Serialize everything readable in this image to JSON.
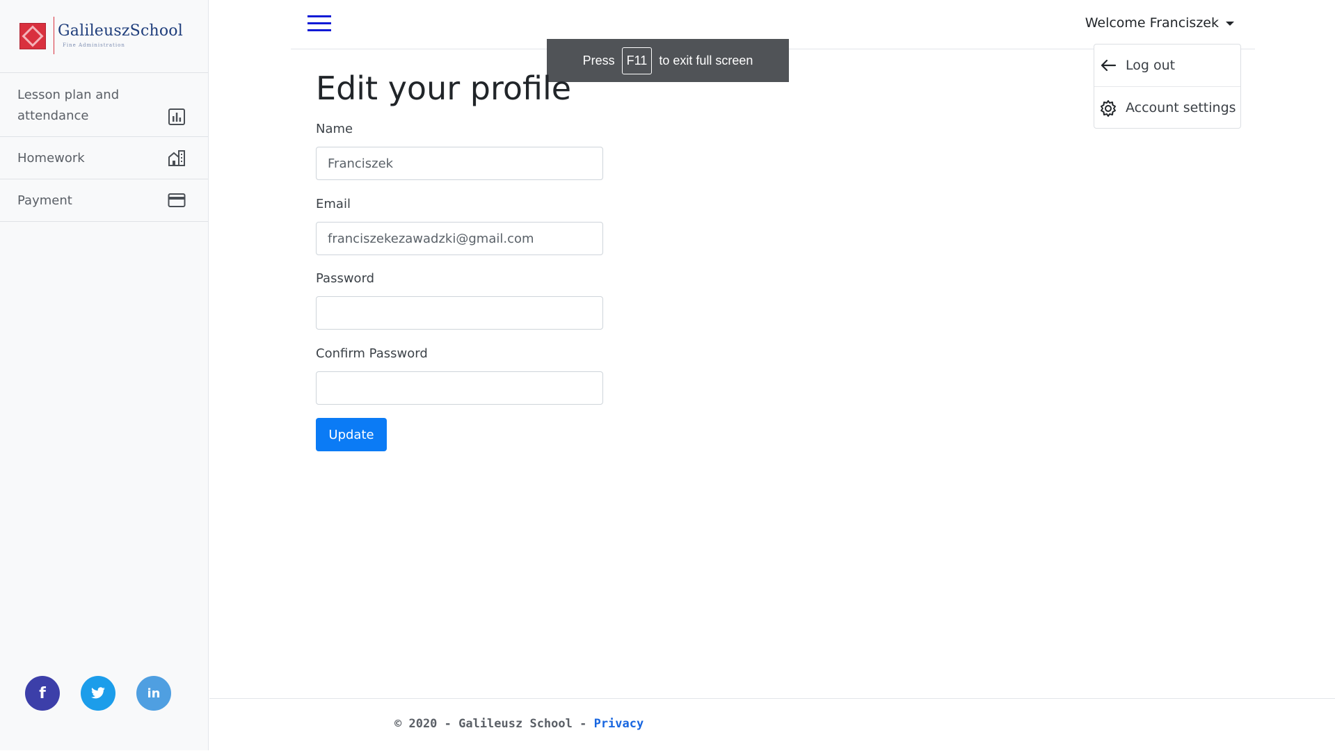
{
  "brand": {
    "name": "GalileuszSchool",
    "subtitle": "Fine Administration"
  },
  "sidebar": {
    "items": [
      {
        "label": "Lesson plan and attendance",
        "icon": "bar-chart-icon"
      },
      {
        "label": "Homework",
        "icon": "building-icon"
      },
      {
        "label": "Payment",
        "icon": "credit-card-icon"
      }
    ],
    "social": [
      {
        "label": "f",
        "icon": "facebook-icon",
        "color": "#3c3fa9"
      },
      {
        "label": "",
        "icon": "twitter-icon",
        "color": "#1c9dea"
      },
      {
        "label": "in",
        "icon": "linkedin-icon",
        "color": "#4f9fe1"
      }
    ]
  },
  "header": {
    "welcome": "Welcome Franciszek",
    "menu": [
      {
        "label": "Log out",
        "icon": "arrow-left-icon"
      },
      {
        "label": "Account settings",
        "icon": "gear-icon"
      }
    ]
  },
  "fullscreen_toast": {
    "before": "Press",
    "key": "F11",
    "after": "to exit full screen"
  },
  "form": {
    "title": "Edit your profile",
    "name_label": "Name",
    "name_value": "Franciszek",
    "email_label": "Email",
    "email_value": "franciszekezawadzki@gmail.com",
    "password_label": "Password",
    "password_value": "",
    "confirm_label": "Confirm Password",
    "confirm_value": "",
    "submit_label": "Update"
  },
  "footer": {
    "text": "© 2020 - Galileusz School -",
    "link": "Privacy"
  },
  "colors": {
    "accent": "#0b7bf5",
    "hamburger": "#0d1ad6",
    "brand_red": "#d9303e"
  }
}
